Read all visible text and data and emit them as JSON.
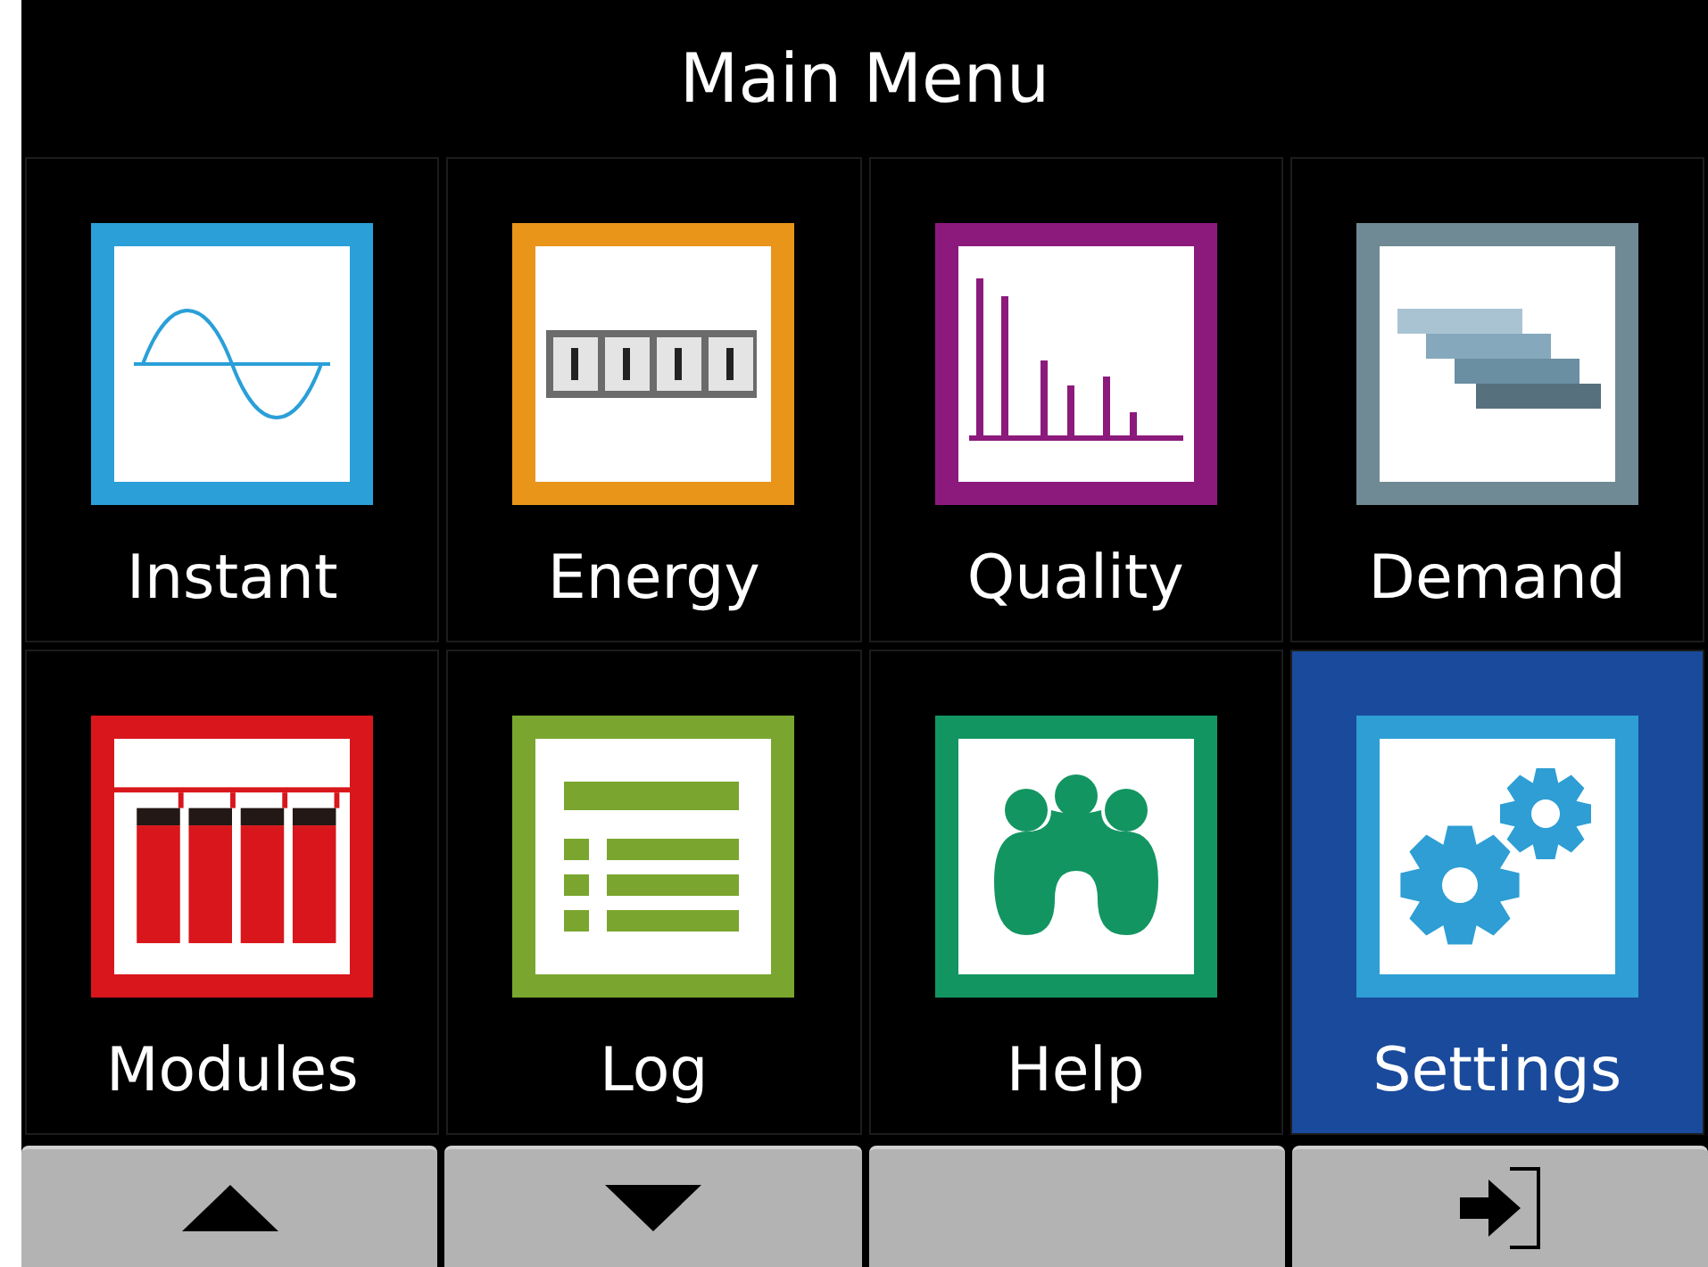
{
  "title": "Main Menu",
  "items": [
    {
      "label": "Instant",
      "kind": "sine",
      "color": "#2a9fd8",
      "selected": false
    },
    {
      "label": "Energy",
      "kind": "meter",
      "color": "#e8951a",
      "selected": false
    },
    {
      "label": "Quality",
      "kind": "harmonics",
      "color": "#8c1a7c",
      "selected": false
    },
    {
      "label": "Demand",
      "kind": "bars",
      "color": "#6f8a94",
      "selected": false
    },
    {
      "label": "Modules",
      "kind": "modules",
      "color": "#d8161b",
      "selected": false
    },
    {
      "label": "Log",
      "kind": "list",
      "color": "#7aa62f",
      "selected": false
    },
    {
      "label": "Help",
      "kind": "people",
      "color": "#139562",
      "selected": false
    },
    {
      "label": "Settings",
      "kind": "gears",
      "color": "#2e9ed4",
      "selected": true
    }
  ],
  "softkeys": [
    {
      "kind": "up"
    },
    {
      "kind": "down"
    },
    {
      "kind": "blank"
    },
    {
      "kind": "enter"
    }
  ]
}
